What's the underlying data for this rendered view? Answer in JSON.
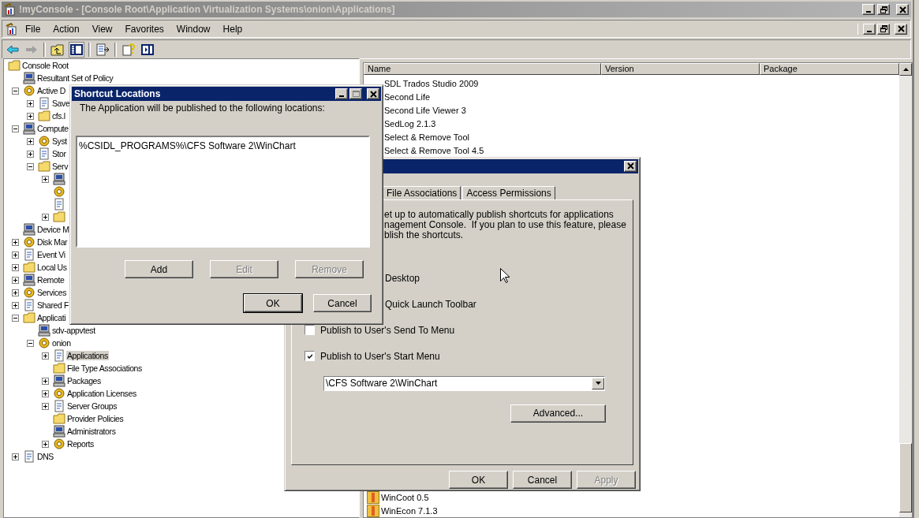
{
  "window": {
    "title": "!myConsole - [Console Root\\Application Virtualization Systems\\onion\\Applications]"
  },
  "menu": [
    "File",
    "Action",
    "View",
    "Favorites",
    "Window",
    "Help"
  ],
  "tree": [
    {
      "label": "Console Root",
      "selected": false,
      "children": [
        {
          "label": "Resultant Set of Policy",
          "selected": false
        },
        {
          "label": "Active D",
          "selected": false,
          "expanded": true,
          "children": [
            {
              "label": "Save",
              "selected": false,
              "expanded": false
            },
            {
              "label": "cfs.l",
              "selected": false,
              "expanded": false
            }
          ]
        },
        {
          "label": "Compute",
          "selected": false,
          "expanded": true,
          "children": [
            {
              "label": "Syst",
              "selected": false,
              "expanded": false
            },
            {
              "label": "Stor",
              "selected": false,
              "expanded": false
            },
            {
              "label": "Serv",
              "selected": false,
              "expanded": true,
              "children": [
                {
                  "selected": false,
                  "expanded": false
                },
                {
                  "selected": false
                },
                {
                  "selected": false
                },
                {
                  "selected": false,
                  "expanded": false
                }
              ]
            }
          ]
        },
        {
          "label": "Device M",
          "selected": false
        },
        {
          "label": "Disk Mar",
          "selected": false,
          "expanded": false
        },
        {
          "label": "Event Vi",
          "selected": false,
          "expanded": false
        },
        {
          "label": "Local Us",
          "selected": false,
          "expanded": false
        },
        {
          "label": "Remote",
          "selected": false,
          "expanded": false
        },
        {
          "label": "Services",
          "selected": false,
          "expanded": false
        },
        {
          "label": "Shared F",
          "selected": false,
          "expanded": false
        },
        {
          "label": "Applicati",
          "selected": false,
          "expanded": true,
          "children": [
            {
              "label": "sdv-appvtest",
              "selected": false
            },
            {
              "label": "onion",
              "selected": false,
              "expanded": true,
              "children": [
                {
                  "label": "Applications",
                  "selected": true,
                  "expanded": false
                },
                {
                  "label": "File Type Associations",
                  "selected": false
                },
                {
                  "label": "Packages",
                  "selected": false,
                  "expanded": false
                },
                {
                  "label": "Application Licenses",
                  "selected": false,
                  "expanded": false
                },
                {
                  "label": "Server Groups",
                  "selected": false,
                  "expanded": false
                },
                {
                  "label": "Provider Policies",
                  "selected": false
                },
                {
                  "label": "Administrators",
                  "selected": false
                },
                {
                  "label": "Reports",
                  "selected": false,
                  "expanded": false
                }
              ]
            }
          ]
        },
        {
          "label": "DNS",
          "selected": false,
          "expanded": false
        }
      ]
    }
  ],
  "list": {
    "columns": [
      "Name",
      "Version",
      "Package"
    ],
    "rows_top": [
      "SDL Trados Studio 2009",
      "Second Life",
      "Second Life Viewer 3",
      "SedLog 2.1.3",
      "Select & Remove Tool",
      "Select & Remove Tool 4.5"
    ],
    "rows_bottom": [
      "WinCoot 0.5",
      "WinEcon 7.1.3"
    ]
  },
  "shortcut_dialog": {
    "title": "Shortcut Locations",
    "intro": "The Application will be published to the following locations:",
    "locations": [
      "%CSIDL_PROGRAMS%\\CFS Software 2\\WinChart"
    ],
    "buttons": [
      {
        "label": "Add",
        "disabled": false
      },
      {
        "label": "Edit",
        "disabled": true
      },
      {
        "label": "Remove",
        "disabled": true
      }
    ],
    "footer_buttons": [
      {
        "label": "OK",
        "default": true
      },
      {
        "label": "Cancel",
        "default": false
      }
    ]
  },
  "properties_dialog": {
    "tabs": [
      {
        "label": "File Associations",
        "selected": false
      },
      {
        "label": "Access Permissions",
        "selected": false
      }
    ],
    "description_lines": [
      "et up to automatically publish shortcuts for applications",
      "nagement Console.  If you plan to use this feature, please",
      "blish the shortcuts."
    ],
    "options": [
      {
        "label": "Desktop"
      },
      {
        "label": "Quick Launch Toolbar"
      },
      {
        "label": "Publish to User's Send To Menu",
        "checked": false
      },
      {
        "label": "Publish to User's Start Menu",
        "checked": true
      }
    ],
    "start_menu_path": "\\CFS Software 2\\WinChart",
    "advanced_button": "Advanced...",
    "footer_buttons": [
      {
        "label": "OK",
        "disabled": false
      },
      {
        "label": "Cancel",
        "disabled": false
      },
      {
        "label": "Apply",
        "disabled": true
      }
    ]
  }
}
